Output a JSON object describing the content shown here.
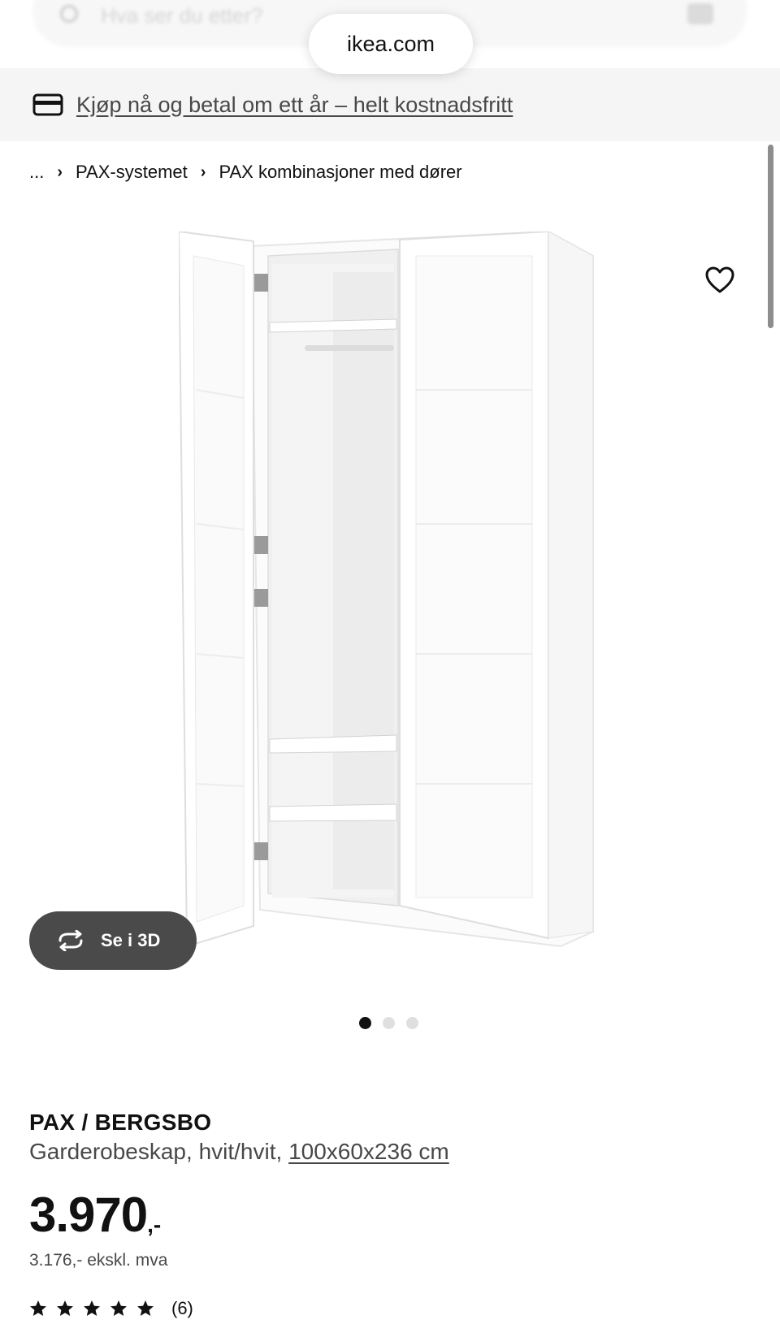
{
  "search": {
    "placeholder": "Hva ser du etter?"
  },
  "browser": {
    "url": "ikea.com"
  },
  "promo": {
    "text": "Kjøp nå og betal om ett år – helt kostnadsfritt",
    "icon": "credit-card-icon"
  },
  "breadcrumb": {
    "items": [
      "...",
      "PAX-systemet",
      "PAX kombinasjoner med dører"
    ],
    "separator": "›"
  },
  "gallery": {
    "view_3d_label": "Se i 3D",
    "image_count": 3,
    "active_index": 0
  },
  "product": {
    "name": "PAX / BERGSBO",
    "description": "Garderobeskap, hvit/hvit,",
    "dimensions": "100x60x236 cm",
    "price": "3.970",
    "price_suffix": ",-",
    "price_ex_vat": "3.176,- ekskl. mva",
    "rating_stars": 5,
    "review_count": "(6)"
  },
  "colors": {
    "text": "#111111",
    "secondary_text": "#484848",
    "promo_bg": "#f5f5f5",
    "button_3d": "#4a4a4a"
  }
}
